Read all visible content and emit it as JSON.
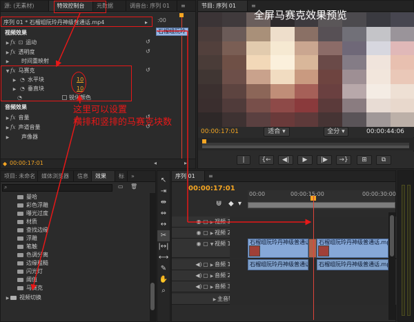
{
  "effect_controls": {
    "tabs": [
      "源: (无素材)",
      "特效控制台",
      "元数据",
      "调音台: 序列 01"
    ],
    "sequence_clip": "序列 01 * 石榴组阮玲丹神级普通话.mp4",
    "time_ruler": ":00",
    "clip_label": "石榴组阮玲",
    "section_video": "视频效果",
    "motion": "运动",
    "opacity": "透明度",
    "time_remap": "时间重映射",
    "mosaic": "马赛克",
    "horizontal_blocks": "水平块",
    "horizontal_value": "10",
    "vertical_blocks": "垂直块",
    "vertical_value": "10",
    "sharpen_colors": "锐化颜色",
    "section_audio": "音频效果",
    "volume": "音量",
    "channel_volume": "声道音量",
    "panner": "声像器",
    "timecode": "00:00:17:01"
  },
  "program_monitor": {
    "tab": "节目: 序列 01",
    "timecode_current": "00:00:17:01",
    "fit": "适合",
    "quality": "全分",
    "timecode_duration": "00:00:44:06",
    "mosaic_colors": [
      [
        "#3b3436",
        "#403a3c",
        "#6a5e5c",
        "#2e2a2c",
        "#3d3a3e",
        "#5a5658",
        "#4c4a4e",
        "#3a3a40",
        "#474650"
      ],
      [
        "#4b3d3b",
        "#6b5b58",
        "#a99079",
        "#eedecb",
        "#8a7065",
        "#575055",
        "#717078",
        "#c4c4c8",
        "#9a949a"
      ],
      [
        "#52403c",
        "#7a5e54",
        "#e2cbae",
        "#f6e9d2",
        "#caa690",
        "#8c6c68",
        "#6f6878",
        "#d7d7df",
        "#e0b8b8"
      ],
      [
        "#4a3c38",
        "#6f5046",
        "#f2d8b8",
        "#fbf0dc",
        "#d9b79a",
        "#6a4a48",
        "#847c86",
        "#f0e4dc",
        "#e8c0b0"
      ],
      [
        "#403633",
        "#6d4f49",
        "#c9a28c",
        "#f1dcc1",
        "#c99a80",
        "#6e4440",
        "#9e8f94",
        "#f2e6dc",
        "#eac8b8"
      ],
      [
        "#3b302f",
        "#5d4440",
        "#8c6658",
        "#c08e78",
        "#a66058",
        "#6a4040",
        "#b8a8aa",
        "#f4ece4",
        "#eee0d4"
      ],
      [
        "#3a2e2e",
        "#503b3a",
        "#784f4a",
        "#8e4a48",
        "#8a3a3c",
        "#5b3a3a",
        "#8a7c80",
        "#e8dcd4",
        "#e8d8cc"
      ],
      [
        "#2e2828",
        "#3e3232",
        "#5a4040",
        "#6a3a3a",
        "#5e3a3a",
        "#463434",
        "#5a5458",
        "#a09898",
        "#bcb0a8"
      ]
    ]
  },
  "annotations": {
    "preview": "全屏马赛克效果预览",
    "settings_line1": "这里可以设置",
    "settings_line2": "横排和竖排的马赛克块数"
  },
  "project": {
    "tabs": [
      "项目: 未命名",
      "媒体浏览器",
      "信息",
      "效果",
      "标"
    ],
    "items": [
      "曼哈",
      "彩色浮雕",
      "曝光过度",
      "材质",
      "查找边缘",
      "浮雕",
      "笔触",
      "色调分离",
      "边缘粗糙",
      "闪光灯",
      "阈值",
      "马赛克"
    ],
    "folder": "视频切换"
  },
  "timeline": {
    "tab": "序列 01",
    "timecode": "00:00:17:01",
    "ruler": [
      "00:00",
      "00:00:15:00",
      "00:00:30:00"
    ],
    "tracks_video": [
      "视频 3",
      "视频 2",
      "视频 1"
    ],
    "tracks_audio": [
      "音频 1",
      "音频 2",
      "音频 3"
    ],
    "master": "主音轨",
    "clip_title": "石榴组阮玲丹神级普通话.mp4"
  }
}
